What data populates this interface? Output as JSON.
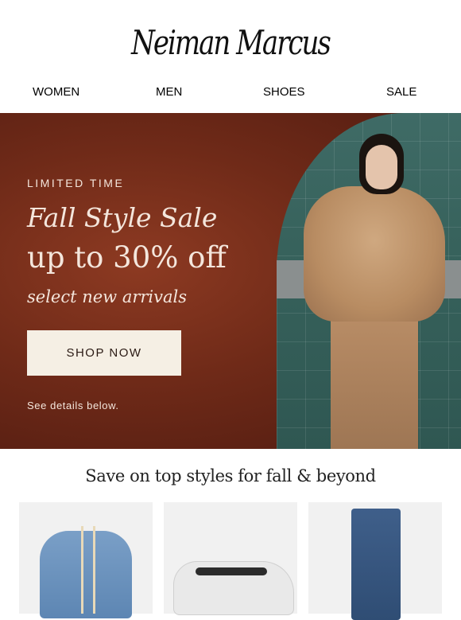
{
  "brand": {
    "logo_text": "Neiman Marcus"
  },
  "nav": {
    "items": [
      "WOMEN",
      "MEN",
      "SHOES",
      "SALE"
    ]
  },
  "hero": {
    "eyebrow": "LIMITED TIME",
    "headline": "Fall Style Sale",
    "offer": "up to 30% off",
    "subline": "select new arrivals",
    "cta_label": "SHOP NOW",
    "details_note": "See details below.",
    "colors": {
      "background": "#6f2a18",
      "text": "#f4e6dc",
      "cta_bg": "#f5efe4"
    }
  },
  "section": {
    "title": "Save on top styles for fall & beyond"
  },
  "products": [
    {
      "image": "denim-tweed-jacket"
    },
    {
      "image": "white-sneaker"
    },
    {
      "image": "blue-jeans"
    }
  ]
}
